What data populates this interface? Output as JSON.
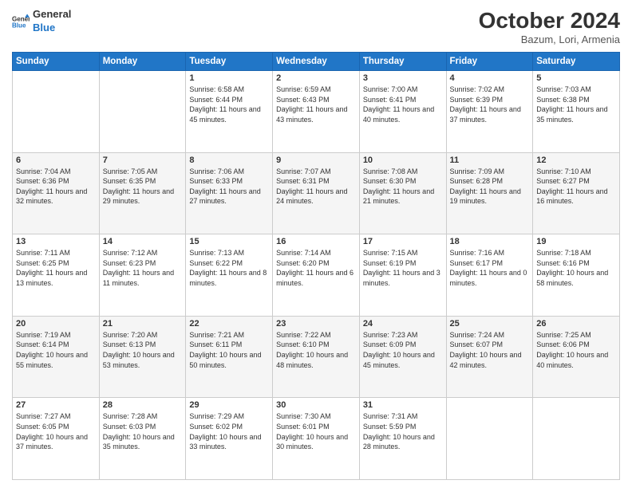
{
  "logo": {
    "line1": "General",
    "line2": "Blue"
  },
  "title": "October 2024",
  "location": "Bazum, Lori, Armenia",
  "days_header": [
    "Sunday",
    "Monday",
    "Tuesday",
    "Wednesday",
    "Thursday",
    "Friday",
    "Saturday"
  ],
  "weeks": [
    [
      {
        "num": "",
        "detail": ""
      },
      {
        "num": "",
        "detail": ""
      },
      {
        "num": "1",
        "detail": "Sunrise: 6:58 AM\nSunset: 6:44 PM\nDaylight: 11 hours and 45 minutes."
      },
      {
        "num": "2",
        "detail": "Sunrise: 6:59 AM\nSunset: 6:43 PM\nDaylight: 11 hours and 43 minutes."
      },
      {
        "num": "3",
        "detail": "Sunrise: 7:00 AM\nSunset: 6:41 PM\nDaylight: 11 hours and 40 minutes."
      },
      {
        "num": "4",
        "detail": "Sunrise: 7:02 AM\nSunset: 6:39 PM\nDaylight: 11 hours and 37 minutes."
      },
      {
        "num": "5",
        "detail": "Sunrise: 7:03 AM\nSunset: 6:38 PM\nDaylight: 11 hours and 35 minutes."
      }
    ],
    [
      {
        "num": "6",
        "detail": "Sunrise: 7:04 AM\nSunset: 6:36 PM\nDaylight: 11 hours and 32 minutes."
      },
      {
        "num": "7",
        "detail": "Sunrise: 7:05 AM\nSunset: 6:35 PM\nDaylight: 11 hours and 29 minutes."
      },
      {
        "num": "8",
        "detail": "Sunrise: 7:06 AM\nSunset: 6:33 PM\nDaylight: 11 hours and 27 minutes."
      },
      {
        "num": "9",
        "detail": "Sunrise: 7:07 AM\nSunset: 6:31 PM\nDaylight: 11 hours and 24 minutes."
      },
      {
        "num": "10",
        "detail": "Sunrise: 7:08 AM\nSunset: 6:30 PM\nDaylight: 11 hours and 21 minutes."
      },
      {
        "num": "11",
        "detail": "Sunrise: 7:09 AM\nSunset: 6:28 PM\nDaylight: 11 hours and 19 minutes."
      },
      {
        "num": "12",
        "detail": "Sunrise: 7:10 AM\nSunset: 6:27 PM\nDaylight: 11 hours and 16 minutes."
      }
    ],
    [
      {
        "num": "13",
        "detail": "Sunrise: 7:11 AM\nSunset: 6:25 PM\nDaylight: 11 hours and 13 minutes."
      },
      {
        "num": "14",
        "detail": "Sunrise: 7:12 AM\nSunset: 6:23 PM\nDaylight: 11 hours and 11 minutes."
      },
      {
        "num": "15",
        "detail": "Sunrise: 7:13 AM\nSunset: 6:22 PM\nDaylight: 11 hours and 8 minutes."
      },
      {
        "num": "16",
        "detail": "Sunrise: 7:14 AM\nSunset: 6:20 PM\nDaylight: 11 hours and 6 minutes."
      },
      {
        "num": "17",
        "detail": "Sunrise: 7:15 AM\nSunset: 6:19 PM\nDaylight: 11 hours and 3 minutes."
      },
      {
        "num": "18",
        "detail": "Sunrise: 7:16 AM\nSunset: 6:17 PM\nDaylight: 11 hours and 0 minutes."
      },
      {
        "num": "19",
        "detail": "Sunrise: 7:18 AM\nSunset: 6:16 PM\nDaylight: 10 hours and 58 minutes."
      }
    ],
    [
      {
        "num": "20",
        "detail": "Sunrise: 7:19 AM\nSunset: 6:14 PM\nDaylight: 10 hours and 55 minutes."
      },
      {
        "num": "21",
        "detail": "Sunrise: 7:20 AM\nSunset: 6:13 PM\nDaylight: 10 hours and 53 minutes."
      },
      {
        "num": "22",
        "detail": "Sunrise: 7:21 AM\nSunset: 6:11 PM\nDaylight: 10 hours and 50 minutes."
      },
      {
        "num": "23",
        "detail": "Sunrise: 7:22 AM\nSunset: 6:10 PM\nDaylight: 10 hours and 48 minutes."
      },
      {
        "num": "24",
        "detail": "Sunrise: 7:23 AM\nSunset: 6:09 PM\nDaylight: 10 hours and 45 minutes."
      },
      {
        "num": "25",
        "detail": "Sunrise: 7:24 AM\nSunset: 6:07 PM\nDaylight: 10 hours and 42 minutes."
      },
      {
        "num": "26",
        "detail": "Sunrise: 7:25 AM\nSunset: 6:06 PM\nDaylight: 10 hours and 40 minutes."
      }
    ],
    [
      {
        "num": "27",
        "detail": "Sunrise: 7:27 AM\nSunset: 6:05 PM\nDaylight: 10 hours and 37 minutes."
      },
      {
        "num": "28",
        "detail": "Sunrise: 7:28 AM\nSunset: 6:03 PM\nDaylight: 10 hours and 35 minutes."
      },
      {
        "num": "29",
        "detail": "Sunrise: 7:29 AM\nSunset: 6:02 PM\nDaylight: 10 hours and 33 minutes."
      },
      {
        "num": "30",
        "detail": "Sunrise: 7:30 AM\nSunset: 6:01 PM\nDaylight: 10 hours and 30 minutes."
      },
      {
        "num": "31",
        "detail": "Sunrise: 7:31 AM\nSunset: 5:59 PM\nDaylight: 10 hours and 28 minutes."
      },
      {
        "num": "",
        "detail": ""
      },
      {
        "num": "",
        "detail": ""
      }
    ]
  ]
}
